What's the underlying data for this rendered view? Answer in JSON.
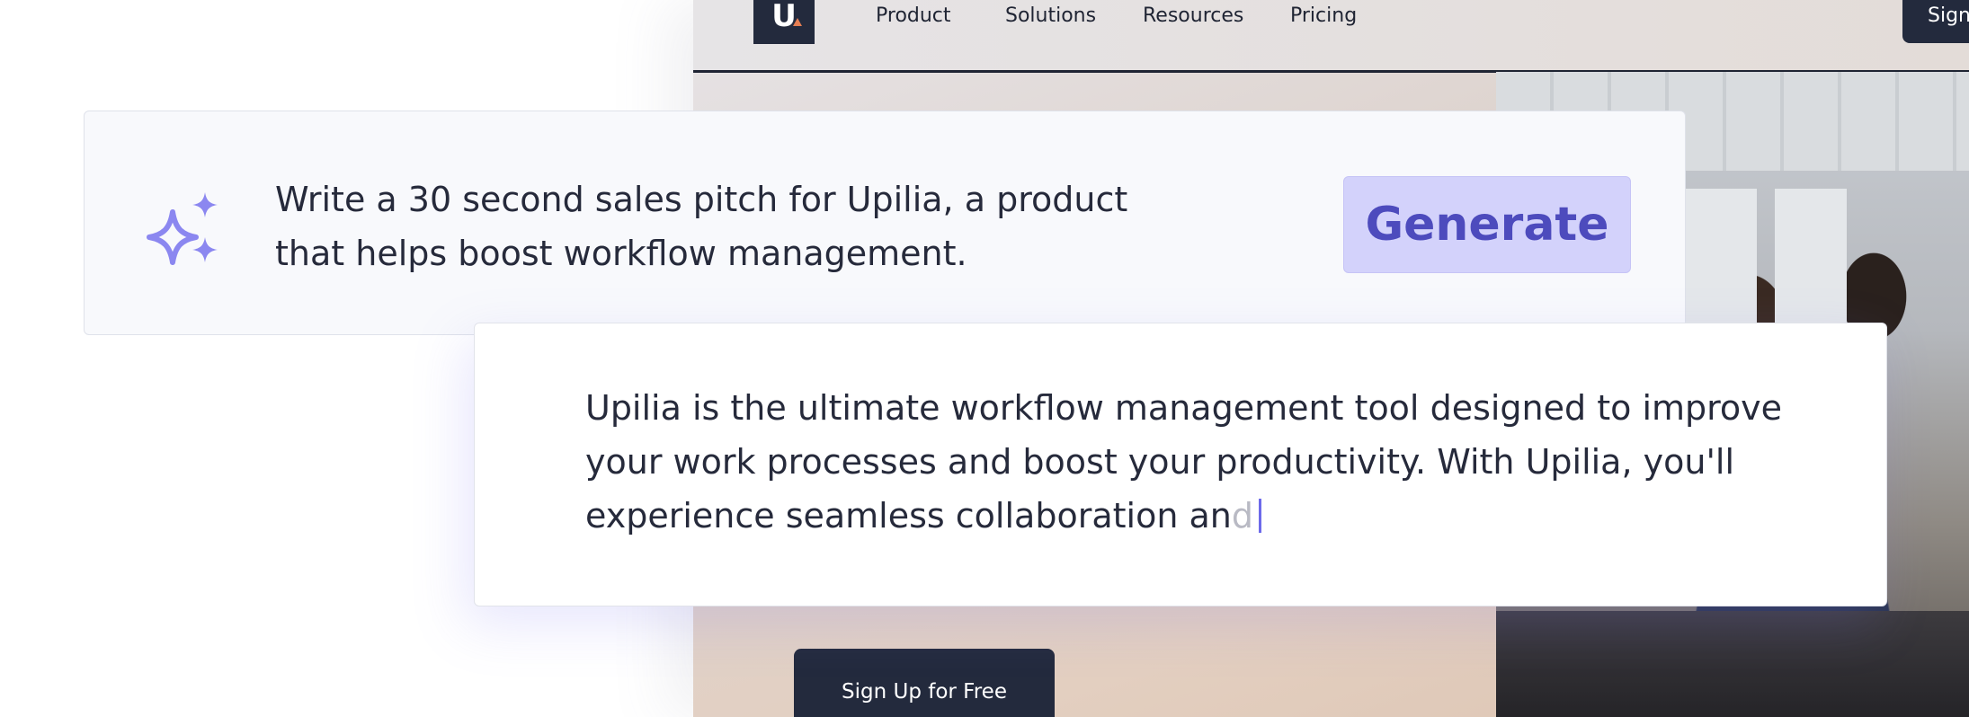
{
  "site": {
    "logo_text": "U",
    "nav": [
      "Product",
      "Solutions",
      "Resources",
      "Pricing"
    ],
    "signin_label": "Sign",
    "cta_label": "Sign Up for Free",
    "accent": "#232a3d",
    "logo_accent": "#e57e53"
  },
  "prompt": {
    "icon": "sparkle-icon",
    "text": "Write a 30 second sales pitch for Upilia, a product that helps boost workflow management.",
    "generate_label": "Generate",
    "button_color": "#d3d2fb",
    "button_text_color": "#4d4bbd"
  },
  "output": {
    "text": "Upilia is the ultimate workflow management tool designed to improve your work processes and boost your productivity. With Upilia, you'll experience seamless collaboration an",
    "fading_text": "d",
    "caret_color": "#6d6aea"
  }
}
